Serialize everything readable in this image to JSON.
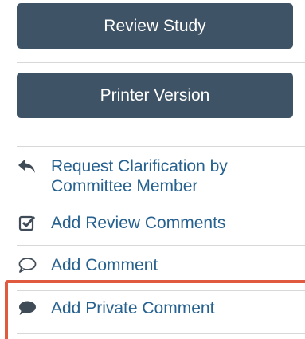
{
  "actions": {
    "review_study": "Review Study",
    "printer_version": "Printer Version"
  },
  "activities": [
    {
      "label": "Request Clarification by Committee Member",
      "icon": "reply-arrow-icon"
    },
    {
      "label": "Add Review Comments",
      "icon": "checkbox-icon"
    },
    {
      "label": "Add Comment",
      "icon": "speech-bubble-outline-icon"
    },
    {
      "label": "Add Private Comment",
      "icon": "speech-bubble-filled-icon"
    }
  ],
  "colors": {
    "button_bg": "#3f5366",
    "link": "#26618f",
    "highlight": "#e05a40"
  }
}
